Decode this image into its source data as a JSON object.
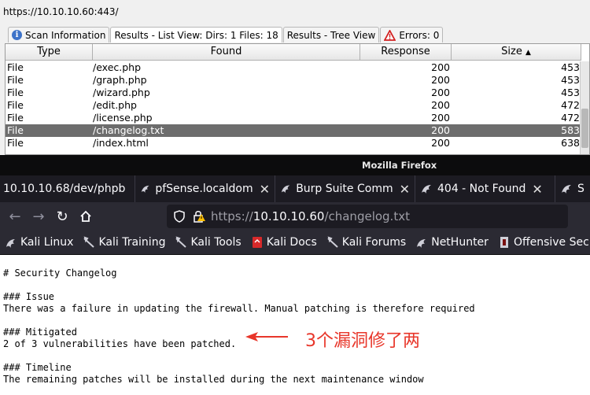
{
  "dirbuster": {
    "url": "https://10.10.10.60:443/",
    "tabs": [
      {
        "label": "Scan Information",
        "icon": "info-icon"
      },
      {
        "label": "Results - List View: Dirs: 1 Files: 18",
        "icon": null
      },
      {
        "label": "Results - Tree View",
        "icon": null
      },
      {
        "label": "Errors: 0",
        "icon": "warning-icon"
      }
    ],
    "columns": {
      "type": "Type",
      "found": "Found",
      "response": "Response",
      "size": "Size"
    },
    "rows": [
      {
        "type": "File",
        "found": "/exec.php",
        "response": "200",
        "size": "453"
      },
      {
        "type": "File",
        "found": "/graph.php",
        "response": "200",
        "size": "453"
      },
      {
        "type": "File",
        "found": "/wizard.php",
        "response": "200",
        "size": "453"
      },
      {
        "type": "File",
        "found": "/edit.php",
        "response": "200",
        "size": "472"
      },
      {
        "type": "File",
        "found": "/license.php",
        "response": "200",
        "size": "472"
      },
      {
        "type": "File",
        "found": "/changelog.txt",
        "response": "200",
        "size": "583",
        "selected": true
      },
      {
        "type": "File",
        "found": "/index.html",
        "response": "200",
        "size": "638"
      }
    ]
  },
  "firefox": {
    "window_title": "Mozilla Firefox",
    "tabs": [
      {
        "label": "10.10.10.68/dev/phpb",
        "close": ""
      },
      {
        "label": "pfSense.localdom",
        "close": "✕"
      },
      {
        "label": "Burp Suite Comm",
        "close": "✕"
      },
      {
        "label": "404 - Not Found",
        "close": "✕"
      },
      {
        "label": "S",
        "close": ""
      }
    ],
    "url": {
      "scheme": "https://",
      "host": "10.10.10.60",
      "path": "/changelog.txt"
    },
    "bookmarks": [
      "Kali Linux",
      "Kali Training",
      "Kali Tools",
      "Kali Docs",
      "Kali Forums",
      "NetHunter",
      "Offensive Security"
    ],
    "page_lines": [
      "# Security Changelog",
      "",
      "### Issue",
      "There was a failure in updating the firewall. Manual patching is therefore required",
      "",
      "### Mitigated",
      "2 of 3 vulnerabilities have been patched.",
      "",
      "### Timeline",
      "The remaining patches will be installed during the next maintenance window"
    ],
    "annotation": "3个漏洞修了两",
    "annotation_color": "#e8362a"
  }
}
